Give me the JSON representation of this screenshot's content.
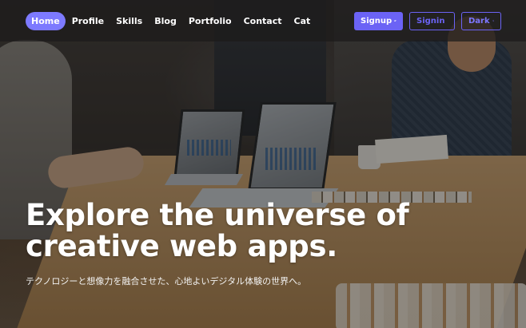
{
  "nav": {
    "items": [
      {
        "label": "Home",
        "active": true
      },
      {
        "label": "Profile",
        "active": false
      },
      {
        "label": "Skills",
        "active": false
      },
      {
        "label": "Blog",
        "active": false
      },
      {
        "label": "Portfolio",
        "active": false
      },
      {
        "label": "Contact",
        "active": false
      },
      {
        "label": "Cat",
        "active": false
      }
    ],
    "signup_label": "Signup",
    "signin_label": "Signin",
    "theme_label": "Dark"
  },
  "hero": {
    "title": "Explore the universe of creative web apps.",
    "subtitle": "テクノロジーと想像力を融合させた、心地よいデジタル体験の世界へ。"
  },
  "colors": {
    "accent": "#6b63f5",
    "active_nav": "#7d7aff"
  },
  "icons": {
    "signup": "user-plus-icon",
    "signin": "sign-in-icon",
    "theme": "moon-icon"
  }
}
